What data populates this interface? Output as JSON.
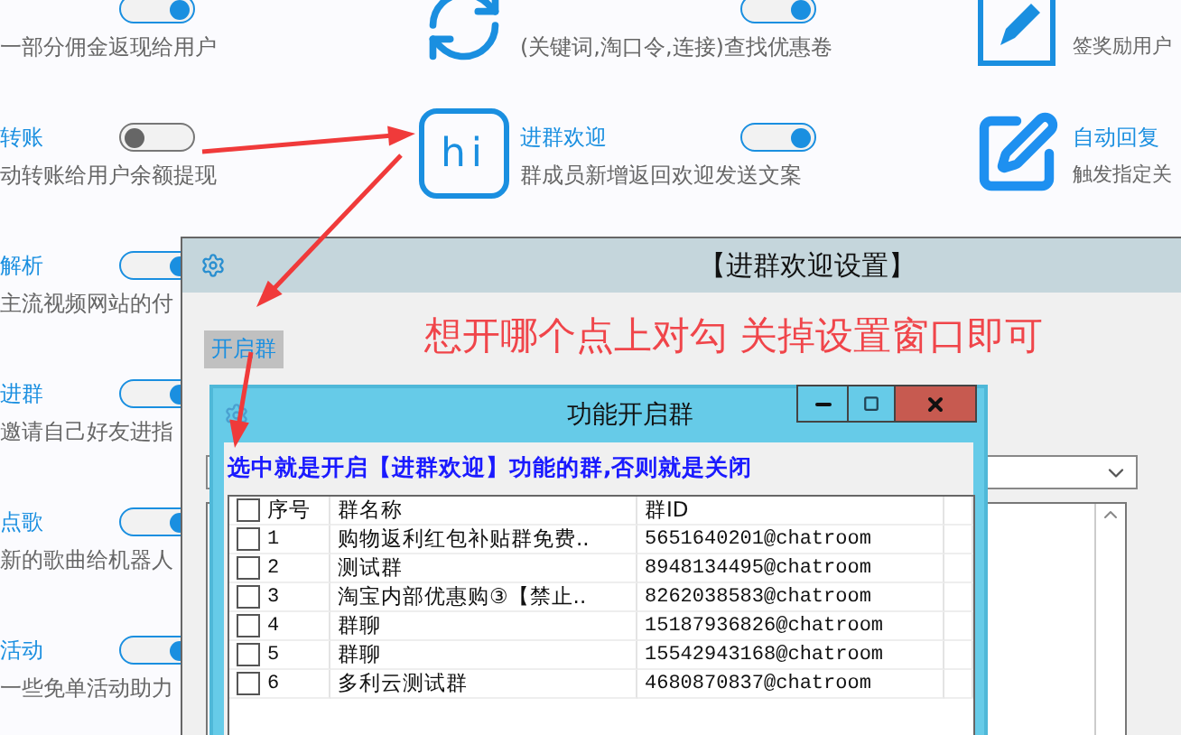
{
  "features": [
    {
      "items": [
        {
          "desc": "一部分佣金返现给用户",
          "on": true
        },
        {
          "title": "转账",
          "desc": "动转账给用户余额提现",
          "on": false
        },
        {
          "title": "解析",
          "desc": "主流视频网站的付",
          "on": true
        },
        {
          "title": "进群",
          "desc": "邀请自己好友进指",
          "on": true
        },
        {
          "title": "点歌",
          "desc": "新的歌曲给机器人",
          "on": true
        },
        {
          "title": "活动",
          "desc": "一些免单活动助力",
          "on": true
        }
      ]
    },
    {
      "items": [
        {
          "kind": "refresh",
          "desc": "(关键词,淘口令,连接)查找优惠卷",
          "on": true
        },
        {
          "kind": "hi",
          "icon_text": "hi",
          "title": "进群欢迎",
          "desc": "群成员新增返回欢迎发送文案",
          "on": true
        }
      ]
    },
    {
      "items": [
        {
          "kind": "notepad",
          "desc": "签奖励用户"
        },
        {
          "kind": "edit",
          "title": "自动回复",
          "desc": "触发指定关"
        }
      ]
    }
  ],
  "settings_window": {
    "title": "【进群欢迎设置】",
    "button": "开启群",
    "hint": "想开哪个点上对勾 关掉设置窗口即可"
  },
  "dialog": {
    "title": "功能开启群",
    "notice": "选中就是开启【进群欢迎】功能的群,否则就是关闭",
    "columns": [
      "序号",
      "群名称",
      "群ID"
    ],
    "header_checked": false,
    "rows": [
      {
        "checked": false,
        "no": "1",
        "name": "购物返利红包补贴群免费..",
        "id": "5651640201@chatroom"
      },
      {
        "checked": false,
        "no": "2",
        "name": "测试群",
        "id": "8948134495@chatroom"
      },
      {
        "checked": false,
        "no": "3",
        "name": "淘宝内部优惠购③【禁止..",
        "id": "8262038583@chatroom"
      },
      {
        "checked": false,
        "no": "4",
        "name": "群聊",
        "id": "15187936826@chatroom"
      },
      {
        "checked": false,
        "no": "5",
        "name": "群聊",
        "id": "15542943168@chatroom"
      },
      {
        "checked": false,
        "no": "6",
        "name": "多利云测试群",
        "id": "4680870837@chatroom"
      }
    ]
  }
}
